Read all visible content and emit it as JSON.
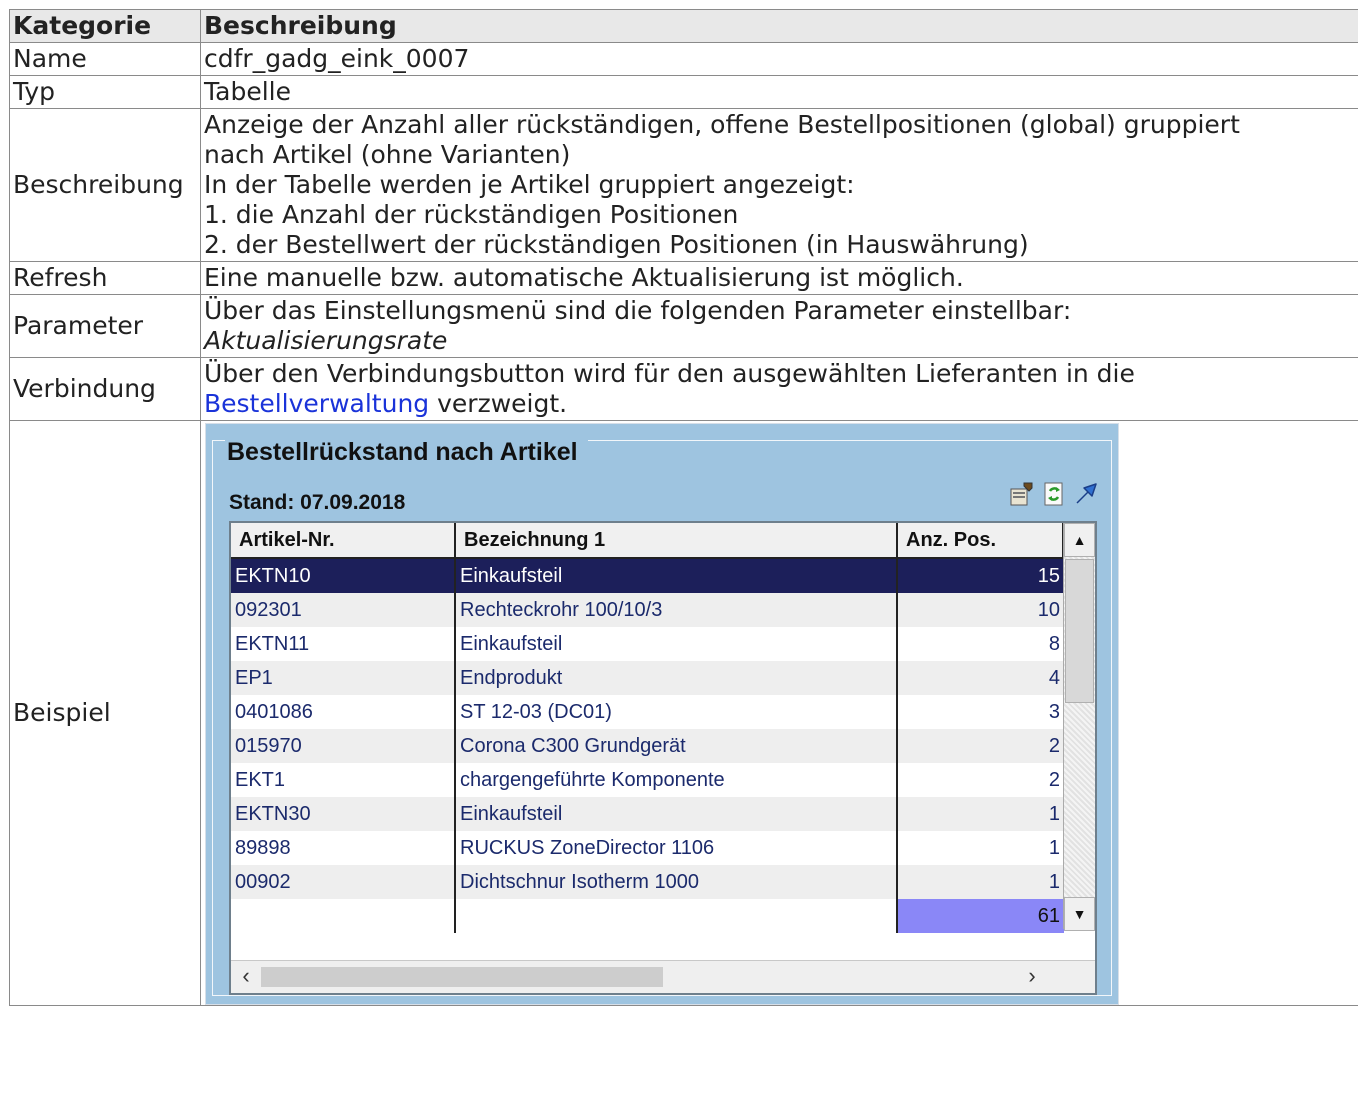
{
  "table": {
    "header": {
      "col1": "Kategorie",
      "col2": "Beschreibung"
    },
    "name": {
      "label": "Name",
      "value": "cdfr_gadg_eink_0007"
    },
    "typ": {
      "label": "Typ",
      "value": "Tabelle"
    },
    "beschreibung": {
      "label": "Beschreibung",
      "lines": [
        "Anzeige der Anzahl aller rückständigen, offene Bestellpositionen (global) gruppiert",
        "nach Artikel (ohne Varianten)",
        "In der Tabelle werden je Artikel gruppiert angezeigt:",
        "1. die Anzahl der rückständigen Positionen",
        "2. der Bestellwert der rückständigen Positionen (in Hauswährung)"
      ]
    },
    "refresh": {
      "label": "Refresh",
      "value": "Eine manuelle bzw. automatische Aktualisierung ist möglich."
    },
    "parameter": {
      "label": "Parameter",
      "line1": "Über das Einstellungsmenü sind die folgenden Parameter einstellbar:",
      "line2": "Aktualisierungsrate"
    },
    "verbindung": {
      "label": "Verbindung",
      "line1": "Über den Verbindungsbutton wird für den ausgewählten Lieferanten in die",
      "link": "Bestellverwaltung",
      "after_link": " verzweigt."
    },
    "beispiel": {
      "label": "Beispiel"
    }
  },
  "widget": {
    "title": "Bestellrückstand nach Artikel",
    "stand": "Stand: 07.09.2018",
    "icons": [
      "settings-icon",
      "refresh-icon",
      "link-arrow-icon"
    ],
    "columns": [
      "Artikel-Nr.",
      "Bezeichnung 1",
      "Anz. Pos."
    ],
    "rows": [
      [
        "EKTN10",
        "Einkaufsteil",
        "15"
      ],
      [
        "092301",
        "Rechteckrohr 100/10/3",
        "10"
      ],
      [
        "EKTN11",
        "Einkaufsteil",
        "8"
      ],
      [
        "EP1",
        "Endprodukt",
        "4"
      ],
      [
        "0401086",
        "ST 12-03 (DC01)",
        "3"
      ],
      [
        "015970",
        "Corona C300 Grundgerät",
        "2"
      ],
      [
        "EKT1",
        "chargengeführte Komponente",
        "2"
      ],
      [
        "EKTN30",
        "Einkaufsteil",
        "1"
      ],
      [
        "89898",
        "RUCKUS ZoneDirector 1106",
        "1"
      ],
      [
        "00902",
        "Dichtschnur Isotherm 1000",
        "1"
      ]
    ],
    "total": "61",
    "selected_row": 0
  }
}
